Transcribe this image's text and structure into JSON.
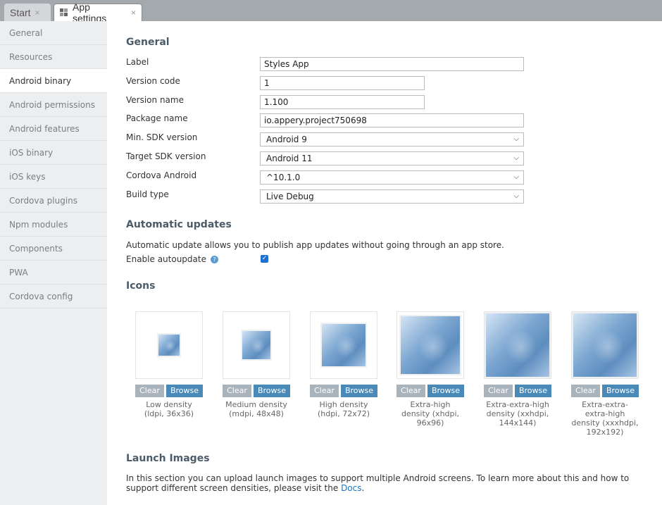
{
  "tabs": [
    {
      "label": "Start",
      "close": "×"
    },
    {
      "label": "App settings",
      "close": "×"
    }
  ],
  "sidebar": {
    "items": [
      {
        "label": "General"
      },
      {
        "label": "Resources"
      },
      {
        "label": "Android binary"
      },
      {
        "label": "Android permissions"
      },
      {
        "label": "Android features"
      },
      {
        "label": "iOS binary"
      },
      {
        "label": "iOS keys"
      },
      {
        "label": "Cordova plugins"
      },
      {
        "label": "Npm modules"
      },
      {
        "label": "Components"
      },
      {
        "label": "PWA"
      },
      {
        "label": "Cordova config"
      }
    ]
  },
  "general": {
    "heading": "General",
    "label": {
      "label": "Label",
      "value": "Styles App"
    },
    "version_code": {
      "label": "Version code",
      "value": "1"
    },
    "version_name": {
      "label": "Version name",
      "value": "1.100"
    },
    "package_name": {
      "label": "Package name",
      "value": "io.appery.project750698"
    },
    "min_sdk": {
      "label": "Min. SDK version",
      "value": "Android 9"
    },
    "target_sdk": {
      "label": "Target SDK version",
      "value": "Android 11"
    },
    "cordova_android": {
      "label": "Cordova Android",
      "value": "^10.1.0"
    },
    "build_type": {
      "label": "Build type",
      "value": "Live Debug"
    }
  },
  "autoupdate": {
    "heading": "Automatic updates",
    "description": "Automatic update allows you to publish app updates without going through an app store.",
    "enable_label": "Enable autoupdate",
    "help": "?",
    "checked": true
  },
  "icons": {
    "heading": "Icons",
    "clear_label": "Clear",
    "browse_label": "Browse",
    "items": [
      {
        "caption": "Low density (ldpi, 36x36)"
      },
      {
        "caption": "Medium density (mdpi, 48x48)"
      },
      {
        "caption": "High density (hdpi, 72x72)"
      },
      {
        "caption": "Extra-high density (xhdpi, 96x96)"
      },
      {
        "caption": "Extra-extra-high density (xxhdpi, 144x144)"
      },
      {
        "caption": "Extra-extra-extra-high density (xxxhdpi, 192x192)"
      }
    ]
  },
  "launch": {
    "heading": "Launch Images",
    "text_before": "In this section you can upload launch images to support multiple Android screens. To learn more about this and how to support different screen densities, please visit the ",
    "link": "Docs",
    "text_after": "."
  },
  "colors": {
    "accent": "#1f6fd1",
    "browse_button": "#4a8ab8",
    "clear_button": "#a8b3bc",
    "heading": "#4b5b69",
    "link": "#1a73c6"
  }
}
